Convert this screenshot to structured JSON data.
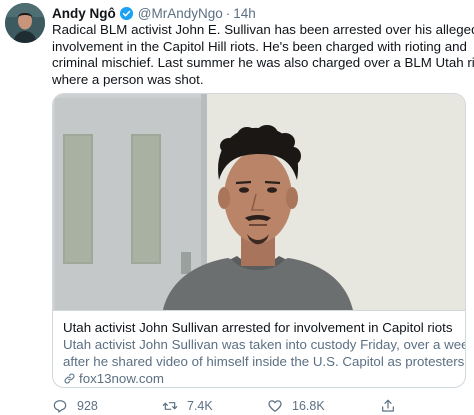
{
  "tweet": {
    "author": {
      "display_name": "Andy Ngô",
      "handle": "@MrAndyNgo",
      "verified": true
    },
    "separator": "·",
    "time": "14h",
    "text_lines": [
      "Radical BLM activist John E. Sullivan has been arrested over his alleged",
      "involvement in the Capitol Hill riots. He's been charged with rioting and",
      "criminal mischief. Last summer he was also charged over a BLM Utah riot",
      "where a person was shot."
    ],
    "card": {
      "title": "Utah activist John Sullivan arrested for involvement in Capitol riots",
      "description_lines": [
        "Utah activist John Sullivan was taken into custody Friday, over a week",
        "after he shared video of himself inside the U.S. Capitol as protesters ..."
      ],
      "domain": "fox13now.com"
    },
    "actions": {
      "replies": "928",
      "retweets": "7.4K",
      "likes": "16.8K"
    }
  },
  "colors": {
    "verified_blue": "#1da1f2",
    "secondary_text": "#5b7083",
    "card_border": "#cfd9de"
  },
  "icons": [
    "verified-badge-icon",
    "link-icon",
    "reply-icon",
    "retweet-icon",
    "like-icon",
    "share-icon"
  ]
}
